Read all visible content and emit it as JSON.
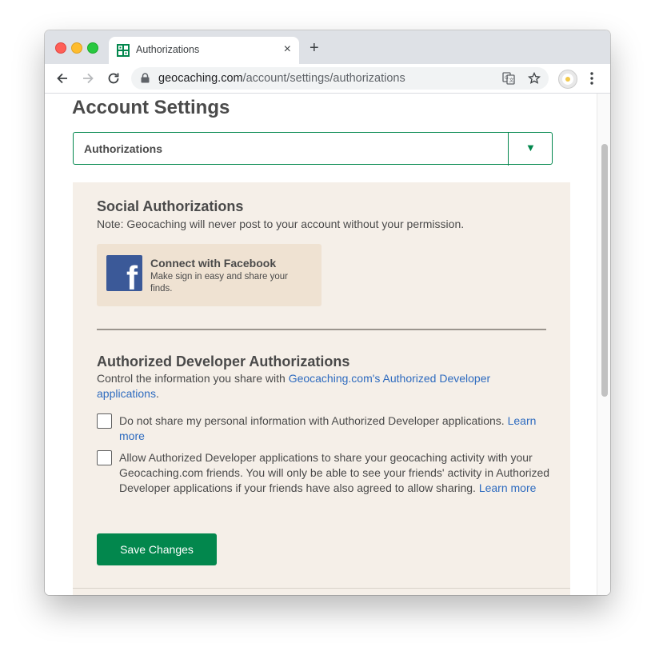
{
  "browser": {
    "tab_title": "Authorizations",
    "tab_close": "×",
    "new_tab": "+",
    "url_host": "geocaching.com",
    "url_path": "/account/settings/authorizations"
  },
  "page": {
    "title": "Account Settings",
    "section_select": {
      "value": "Authorizations",
      "arrow": "▼"
    }
  },
  "social": {
    "heading": "Social Authorizations",
    "note": "Note: Geocaching will never post to your account without your permission.",
    "facebook": {
      "logo_letter": "f",
      "title": "Connect with Facebook",
      "subtitle": "Make sign in easy and share your finds."
    }
  },
  "developer": {
    "heading": "Authorized Developer Authorizations",
    "intro_text": "Control the information you share with ",
    "intro_link": "Geocaching.com's Authorized Developer applications",
    "intro_end": ".",
    "options": [
      {
        "text": "Do not share my personal information with Authorized Developer applications. ",
        "link": "Learn more",
        "checked": false
      },
      {
        "text": "Allow Authorized Developer applications to share your geocaching activity with your Geocaching.com friends. You will only be able to see your friends' activity in Authorized Developer applications if your friends have also agreed to allow sharing. ",
        "link": "Learn more",
        "checked": false
      }
    ],
    "save_label": "Save Changes"
  },
  "colors": {
    "brand_green": "#02874d",
    "panel_bg": "#f5efe8",
    "facebook_blue": "#3b5998",
    "link_blue": "#2e6bbf"
  }
}
